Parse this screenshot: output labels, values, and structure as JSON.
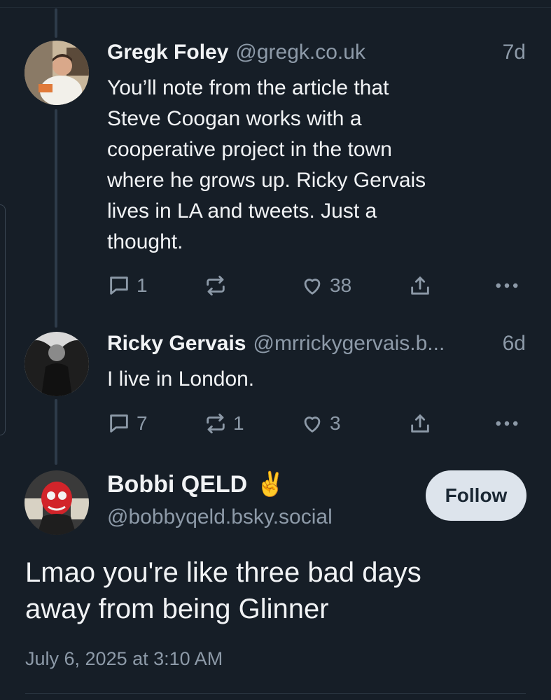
{
  "posts": [
    {
      "name": "Gregk Foley",
      "handle": "@gregk.co.uk",
      "time": "7d",
      "text_lines": [
        "You’ll note from the article that",
        "Steve Coogan works with a",
        "cooperative project in the town",
        "where he grows up. Ricky Gervais",
        "lives in LA and tweets. Just a",
        "thought."
      ],
      "replies": "1",
      "reposts": "",
      "likes": "38"
    },
    {
      "name": "Ricky Gervais",
      "handle": "@mrrickygervais.b...",
      "time": "6d",
      "text_lines": [
        "I live in London."
      ],
      "replies": "7",
      "reposts": "1",
      "likes": "3"
    }
  ],
  "main_post": {
    "name": "Bobbi QELD",
    "emoji": "✌️",
    "handle": "@bobbyqeld.bsky.social",
    "follow_label": "Follow",
    "text_lines": [
      "Lmao you're like three bad days",
      "away from being Glinner"
    ],
    "date": "July 6, 2025 at 3:10 AM"
  },
  "icons": {
    "reply": "speech-bubble-icon",
    "repost": "repost-arrows-icon",
    "like": "heart-icon",
    "share": "share-upload-icon",
    "more": "ellipsis-icon"
  },
  "colors": {
    "background": "#161e27",
    "muted_text": "#8d9aa8",
    "follow_bg": "#dde4ec"
  }
}
